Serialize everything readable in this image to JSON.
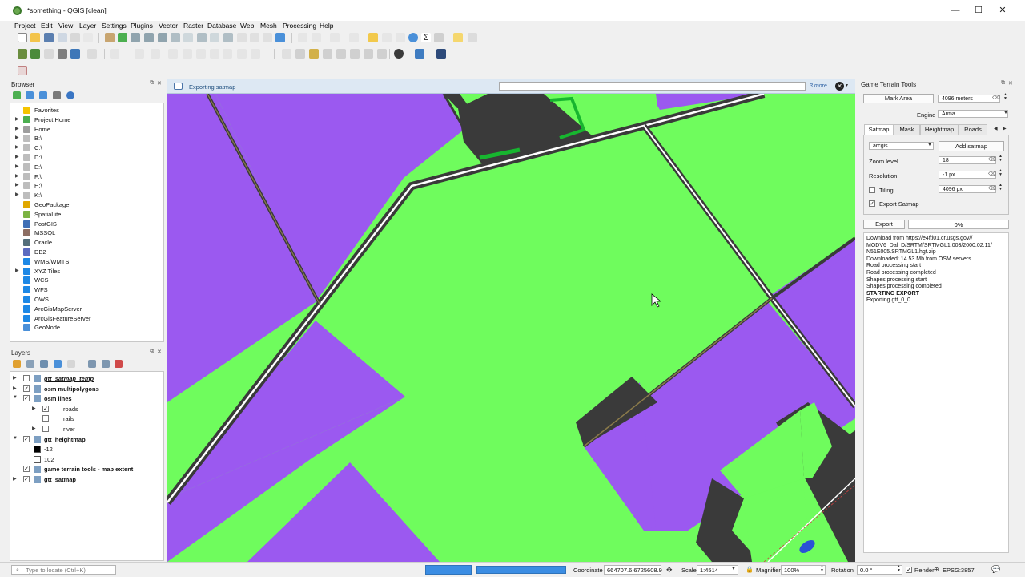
{
  "window": {
    "title": "*something - QGIS [clean]",
    "controls": [
      "—",
      "☐",
      "✕"
    ]
  },
  "menu": [
    "Project",
    "Edit",
    "View",
    "Layer",
    "Settings",
    "Plugins",
    "Vector",
    "Raster",
    "Database",
    "Web",
    "Mesh",
    "Processing",
    "Help"
  ],
  "browser": {
    "title": "Browser",
    "items": [
      {
        "label": "Favorites",
        "expand": "",
        "icon": "#f5c400"
      },
      {
        "label": "Project Home",
        "expand": "▶",
        "icon": "#4caf50"
      },
      {
        "label": "Home",
        "expand": "▶",
        "icon": "#9e9e9e"
      },
      {
        "label": "B:\\",
        "expand": "▶",
        "icon": "#bdbdbd"
      },
      {
        "label": "C:\\",
        "expand": "▶",
        "icon": "#bdbdbd"
      },
      {
        "label": "D:\\",
        "expand": "▶",
        "icon": "#bdbdbd"
      },
      {
        "label": "E:\\",
        "expand": "▶",
        "icon": "#bdbdbd"
      },
      {
        "label": "F:\\",
        "expand": "▶",
        "icon": "#bdbdbd"
      },
      {
        "label": "H:\\",
        "expand": "▶",
        "icon": "#bdbdbd"
      },
      {
        "label": "K:\\",
        "expand": "▶",
        "icon": "#bdbdbd"
      },
      {
        "label": "GeoPackage",
        "expand": "",
        "icon": "#e0a800"
      },
      {
        "label": "SpatiaLite",
        "expand": "",
        "icon": "#7cb342"
      },
      {
        "label": "PostGIS",
        "expand": "",
        "icon": "#3f6fb5"
      },
      {
        "label": "MSSQL",
        "expand": "",
        "icon": "#8d6e63"
      },
      {
        "label": "Oracle",
        "expand": "",
        "icon": "#546e7a"
      },
      {
        "label": "DB2",
        "expand": "",
        "icon": "#5c6bc0"
      },
      {
        "label": "WMS/WMTS",
        "expand": "",
        "icon": "#1e88e5"
      },
      {
        "label": "XYZ Tiles",
        "expand": "▶",
        "icon": "#1e88e5"
      },
      {
        "label": "WCS",
        "expand": "",
        "icon": "#1e88e5"
      },
      {
        "label": "WFS",
        "expand": "",
        "icon": "#1e88e5"
      },
      {
        "label": "OWS",
        "expand": "",
        "icon": "#1e88e5"
      },
      {
        "label": "ArcGisMapServer",
        "expand": "",
        "icon": "#1e88e5"
      },
      {
        "label": "ArcGisFeatureServer",
        "expand": "",
        "icon": "#1e88e5"
      },
      {
        "label": "GeoNode",
        "expand": "",
        "icon": "#4a90d9"
      }
    ]
  },
  "layers": {
    "title": "Layers",
    "items": [
      {
        "label": "gtt_satmap_temp",
        "indent": 0,
        "expand": "▶",
        "checked": false,
        "bold": true,
        "italic": true
      },
      {
        "label": "osm multipolygons",
        "indent": 0,
        "expand": "▶",
        "checked": true,
        "bold": true,
        "italic": false
      },
      {
        "label": "osm lines",
        "indent": 0,
        "expand": "▼",
        "checked": true,
        "bold": true,
        "italic": false
      },
      {
        "label": "roads",
        "indent": 1,
        "expand": "▶",
        "checked": true,
        "bold": false,
        "italic": false
      },
      {
        "label": "rails",
        "indent": 1,
        "expand": "",
        "checked": false,
        "bold": false,
        "italic": false
      },
      {
        "label": "river",
        "indent": 1,
        "expand": "▶",
        "checked": false,
        "bold": false,
        "italic": false
      },
      {
        "label": "gtt_heightmap",
        "indent": 0,
        "expand": "▼",
        "checked": true,
        "bold": true,
        "italic": false
      },
      {
        "label": "-12",
        "indent": 1,
        "expand": "",
        "checked": null,
        "bold": false,
        "italic": false,
        "swatch": "#000000"
      },
      {
        "label": "102",
        "indent": 1,
        "expand": "",
        "checked": null,
        "bold": false,
        "italic": false,
        "swatch": "#ffffff"
      },
      {
        "label": "game terrain tools - map extent",
        "indent": 0,
        "expand": "",
        "checked": true,
        "bold": true,
        "italic": false
      },
      {
        "label": "gtt_satmap",
        "indent": 0,
        "expand": "▶",
        "checked": true,
        "bold": true,
        "italic": false
      }
    ]
  },
  "messagebar": {
    "text": "Exporting satmap",
    "more": "3 more"
  },
  "gtt": {
    "title": "Game Terrain Tools",
    "mark_area": "Mark Area",
    "area_value": "4096 meters",
    "engine_label": "Engine",
    "engine_value": "Arma",
    "tabs": [
      "Satmap",
      "Mask",
      "Heightmap",
      "Roads"
    ],
    "source": "arcgis",
    "add_satmap": "Add satmap",
    "zoom_label": "Zoom level",
    "zoom_value": "18",
    "resolution_label": "Resolution",
    "resolution_value": "-1 px",
    "tiling_label": "Tiling",
    "tiling_value": "4096 px",
    "export_satmap_label": "Export Satmap",
    "export_button": "Export",
    "progress_text": "0%",
    "progress": 0,
    "log": [
      "Download from https://e4ftl01.cr.usgs.gov//",
      "MODV6_Dal_D/SRTM/SRTMGL1.003/2000.02.11/",
      "N51E005.SRTMGL1.hgt.zip",
      "Downloaded: 14.53 Mb from OSM servers...",
      "Road processing start",
      "Road processing completed",
      "Shapes processing start",
      "Shapes processing completed",
      "STARTING EXPORT",
      "Exporting gtt_0_0"
    ]
  },
  "status": {
    "locate_placeholder": "Type to locate (Ctrl+K)",
    "coordinate_label": "Coordinate",
    "coordinate_value": "664707.6,6725608.9",
    "scale_label": "Scale",
    "scale_value": "1:4514",
    "magnifier_label": "Magnifier",
    "magnifier_value": "100%",
    "rotation_label": "Rotation",
    "rotation_value": "0.0 °",
    "render_label": "Render",
    "crs": "EPSG:3857"
  },
  "colors": {
    "field": "#6ffc5d",
    "landuse": "#9b59f0",
    "building": "#3a3a3a",
    "road_casing": "#3a3a3a",
    "road_fill": "#ffffff"
  }
}
